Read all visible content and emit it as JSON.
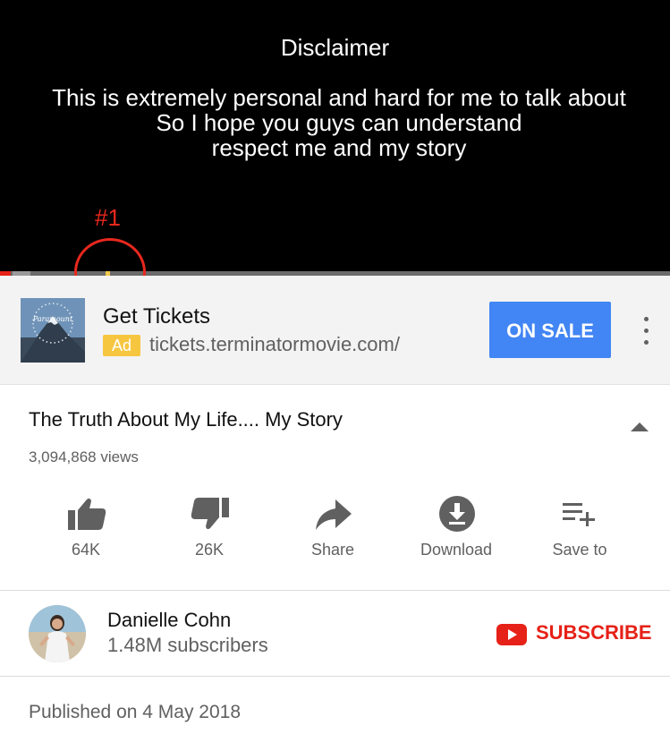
{
  "player": {
    "disclaimer_title": "Disclaimer",
    "disclaimer_lines": [
      "This is extremely personal and hard for me to talk about",
      "So I hope you guys can understand",
      "respect me and my story"
    ],
    "annotation_label": "#1",
    "progress_fraction": 0.005,
    "colors": {
      "played": "#e62117",
      "ad_marker": "#f2c94c",
      "annotation": "#e8281e"
    }
  },
  "ad": {
    "thumb_icon": "paramount-logo-icon",
    "title": "Get Tickets",
    "badge": "Ad",
    "url": "tickets.terminatormovie.com/",
    "cta": "ON SALE",
    "menu_icon": "more-vert-icon",
    "cta_color": "#4285f4",
    "badge_color": "#f7c640"
  },
  "video": {
    "title": "The Truth About My Life.... My Story",
    "views": "3,094,868 views",
    "actions": [
      {
        "icon": "thumbs-up-icon",
        "label": "64K"
      },
      {
        "icon": "thumbs-down-icon",
        "label": "26K"
      },
      {
        "icon": "share-icon",
        "label": "Share"
      },
      {
        "icon": "download-icon",
        "label": "Download"
      },
      {
        "icon": "playlist-add-icon",
        "label": "Save to"
      }
    ]
  },
  "channel": {
    "name": "Danielle Cohn",
    "subscribers": "1.48M subscribers",
    "subscribe_label": "SUBSCRIBE",
    "subscribe_color": "#e62117"
  },
  "published": "Published on 4 May 2018"
}
